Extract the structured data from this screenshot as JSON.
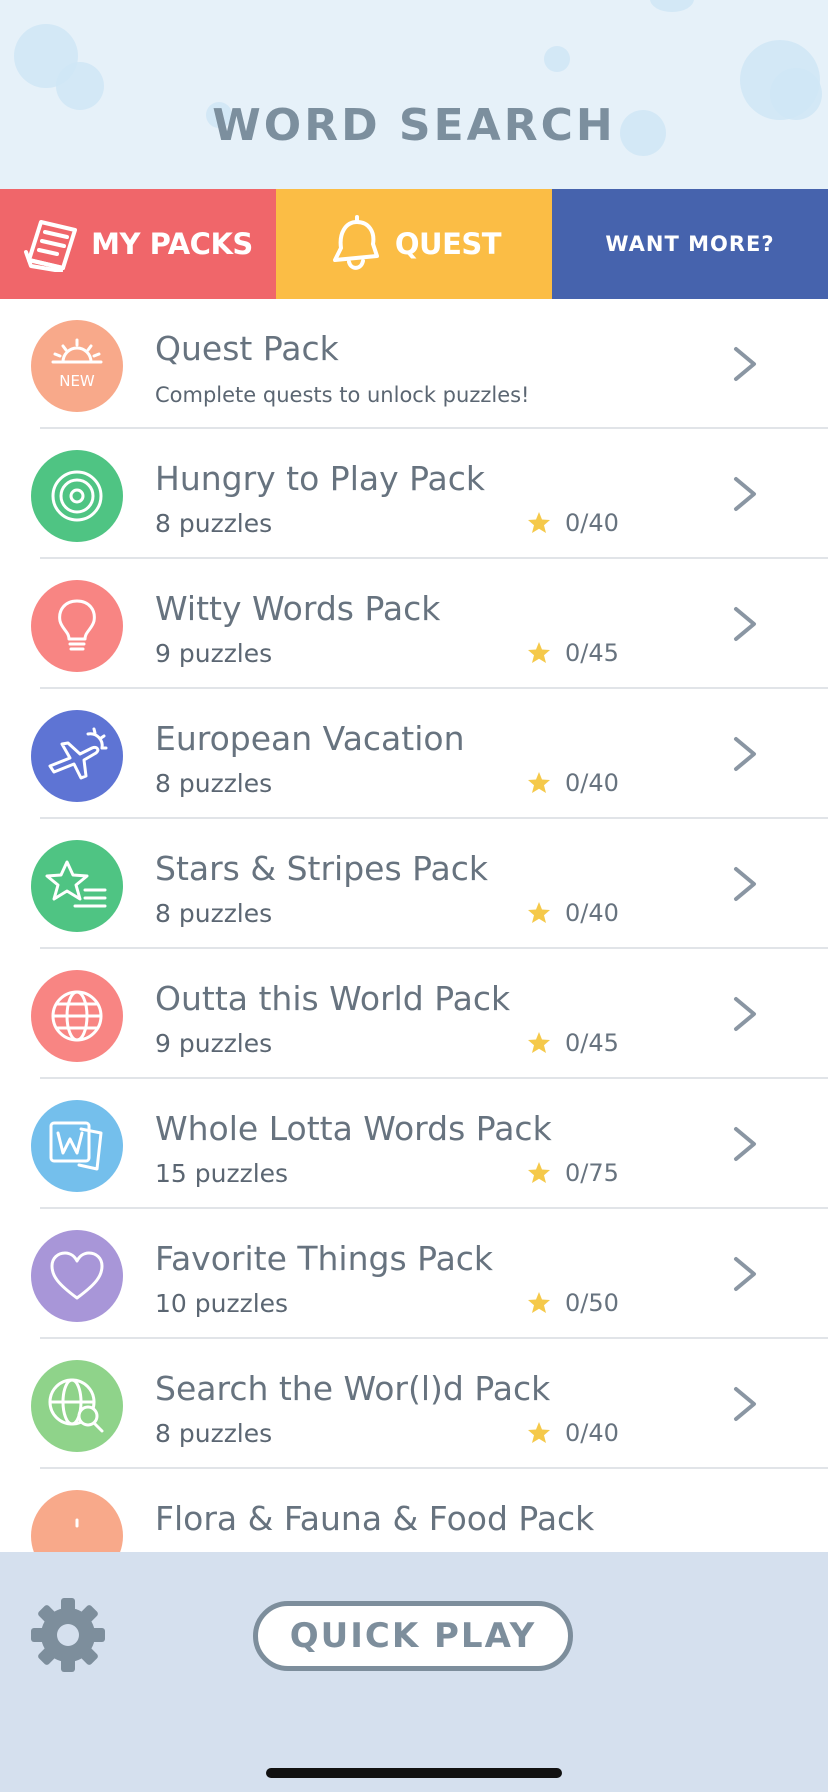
{
  "header": {
    "title": "WORD SEARCH"
  },
  "tabs": {
    "my_packs": {
      "label": "MY PACKS",
      "icon": "newspaper-icon",
      "color": "#f0666a",
      "active": true
    },
    "quest": {
      "label": "QUEST",
      "icon": "bell-icon",
      "color": "#fbbd45"
    },
    "want_more": {
      "label": "WANT MORE?",
      "color": "#4663ad"
    }
  },
  "packs": [
    {
      "name": "Quest Pack",
      "subtitle": "Complete quests to unlock puzzles!",
      "icon": "sunrise-new-icon",
      "badge": "NEW",
      "color": "#f8a98a"
    },
    {
      "name": "Hungry to Play Pack",
      "subtitle": "8 puzzles",
      "stars": "0/40",
      "icon": "disc-icon",
      "color": "#4fc483"
    },
    {
      "name": "Witty Words Pack",
      "subtitle": "9 puzzles",
      "stars": "0/45",
      "icon": "lightbulb-icon",
      "color": "#f88583"
    },
    {
      "name": "European Vacation",
      "subtitle": "8 puzzles",
      "stars": "0/40",
      "icon": "airplane-icon",
      "color": "#5e74d4"
    },
    {
      "name": "Stars & Stripes Pack",
      "subtitle": "8 puzzles",
      "stars": "0/40",
      "icon": "star-stripes-icon",
      "color": "#4fc483"
    },
    {
      "name": "Outta this World Pack",
      "subtitle": "9 puzzles",
      "stars": "0/45",
      "icon": "globe-icon",
      "color": "#f88583"
    },
    {
      "name": "Whole Lotta Words Pack",
      "subtitle": "15 puzzles",
      "stars": "0/75",
      "icon": "word-document-icon",
      "color": "#74bfec"
    },
    {
      "name": "Favorite Things Pack",
      "subtitle": "10 puzzles",
      "stars": "0/50",
      "icon": "heart-icon",
      "color": "#a896d8"
    },
    {
      "name": "Search the Wor(l)d Pack",
      "subtitle": "8 puzzles",
      "stars": "0/40",
      "icon": "globe-search-icon",
      "color": "#8fd38a"
    },
    {
      "name": "Flora & Fauna & Food Pack",
      "icon": "leaf-icon",
      "color": "#f8a98a"
    }
  ],
  "bottom": {
    "quick_play_label": "QUICK PLAY",
    "settings_icon": "gear-icon"
  }
}
